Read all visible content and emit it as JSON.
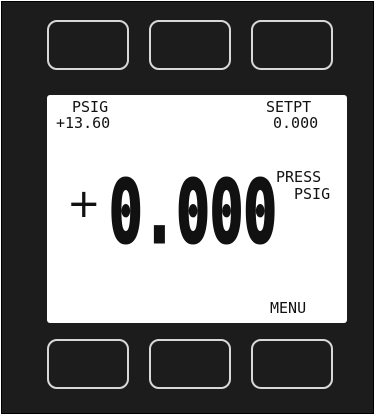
{
  "screen": {
    "top_left": {
      "label": "PSIG",
      "value": "+13.60"
    },
    "top_right": {
      "label": "SETPT",
      "value": "0.000"
    },
    "reading": {
      "sign": "+",
      "value": "0.000",
      "units_line1": "PRESS",
      "units_line2": "PSIG"
    },
    "menu_label": "MENU"
  },
  "colors": {
    "bezel": "#1c1c1c",
    "screen_bg": "#ffffff",
    "text": "#111111",
    "key_outline": "#d8d8d8"
  }
}
